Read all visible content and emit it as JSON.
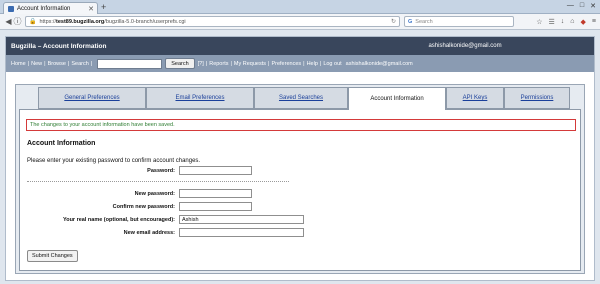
{
  "browser": {
    "tab_title": "Account Information",
    "url_prefix": "https://",
    "url_host": "test89.bugzilla.org",
    "url_path": "/bugzilla-5.0-branch/userprefs.cgi",
    "search_placeholder": "Search"
  },
  "header": {
    "title": "Bugzilla – Account Information",
    "user_email": "ashishalkonide@gmail.com"
  },
  "nav": {
    "home": "Home",
    "new": "New",
    "browse": "Browse",
    "search": "Search",
    "search_button": "Search",
    "help_bracket": "[?]",
    "reports": "Reports",
    "my_requests": "My Requests",
    "preferences": "Preferences",
    "help": "Help",
    "log_out": "Log out",
    "user_email": "ashishalkonide@gmail.com",
    "sep": "|"
  },
  "tabs": [
    {
      "label": "General Preferences"
    },
    {
      "label": "Email Preferences"
    },
    {
      "label": "Saved Searches"
    },
    {
      "label": "Account Information",
      "active": true
    },
    {
      "label": "API Keys"
    },
    {
      "label": "Permissions"
    }
  ],
  "content": {
    "message": "The changes to your account information have been saved.",
    "section_title": "Account Information",
    "intro": "Please enter your existing password to confirm account changes.",
    "password_label": "Password:",
    "new_password_label": "New password:",
    "confirm_password_label": "Confirm new password:",
    "real_name_label": "Your real name (optional, but encouraged):",
    "real_name_value": "Ashish",
    "new_email_label": "New email address:",
    "submit_label": "Submit Changes"
  },
  "colors": {
    "header_bg": "#39465c",
    "nav_bg": "#8a9bb2",
    "message_border": "#d43a3a",
    "message_text": "#2e7d32",
    "tab_link": "#1a3f9a"
  }
}
